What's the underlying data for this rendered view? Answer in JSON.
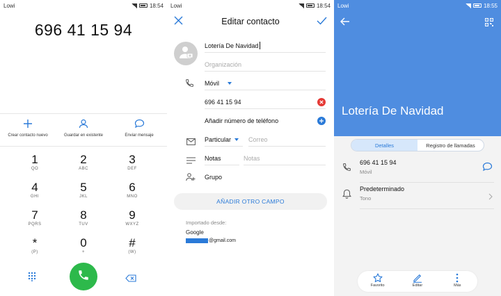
{
  "status_bars": [
    {
      "carrier": "Lowi",
      "time": "18:54"
    },
    {
      "carrier": "Lowi",
      "time": "18:54"
    },
    {
      "carrier": "Lowi",
      "time": "18:55"
    }
  ],
  "dialer": {
    "number": "696 41 15 94",
    "actions": [
      {
        "label": "Crear contacto nuevo",
        "icon": "plus-icon"
      },
      {
        "label": "Guardar en existente",
        "icon": "person-icon"
      },
      {
        "label": "Enviar mensaje",
        "icon": "message-icon"
      }
    ],
    "keys": [
      {
        "digit": "1",
        "letters": "QO"
      },
      {
        "digit": "2",
        "letters": "ABC"
      },
      {
        "digit": "3",
        "letters": "DEF"
      },
      {
        "digit": "4",
        "letters": "GHI"
      },
      {
        "digit": "5",
        "letters": "JKL"
      },
      {
        "digit": "6",
        "letters": "MNO"
      },
      {
        "digit": "7",
        "letters": "PQRS"
      },
      {
        "digit": "8",
        "letters": "TUV"
      },
      {
        "digit": "9",
        "letters": "WXYZ"
      },
      {
        "digit": "*",
        "letters": "(P)"
      },
      {
        "digit": "0",
        "letters": "+"
      },
      {
        "digit": "#",
        "letters": "(W)"
      }
    ],
    "call_color": "#2db94b",
    "accent": "#2a7ad8"
  },
  "edit_contact": {
    "title": "Editar contacto",
    "name_value": "Lotería De Navidad",
    "organization_placeholder": "Organización",
    "phone_type": "Móvil",
    "phone_value": "696 41 15 94",
    "add_phone_label": "Añadir número de teléfono",
    "email_type": "Particular",
    "email_placeholder": "Correo",
    "notes_label": "Notas",
    "notes_placeholder": "Notas",
    "group_label": "Grupo",
    "add_field_label": "AÑADIR OTRO CAMPO",
    "imported_label": "Importado desde:",
    "imported_source": "Google",
    "imported_email_suffix": "@gmail.com"
  },
  "contact_details": {
    "name": "Lotería De Navidad",
    "header_color": "#4f8de0",
    "tabs": [
      {
        "label": "Detalles",
        "active": true
      },
      {
        "label": "Registro de llamadas",
        "active": false
      }
    ],
    "phone_value": "696 41 15 94",
    "phone_type": "Móvil",
    "ringtone_value": "Predeterminado",
    "ringtone_label": "Tono",
    "bottom_actions": [
      {
        "label": "Favorito",
        "icon": "star-icon"
      },
      {
        "label": "Editar",
        "icon": "pencil-icon"
      },
      {
        "label": "Más",
        "icon": "more-vertical-icon"
      }
    ]
  }
}
